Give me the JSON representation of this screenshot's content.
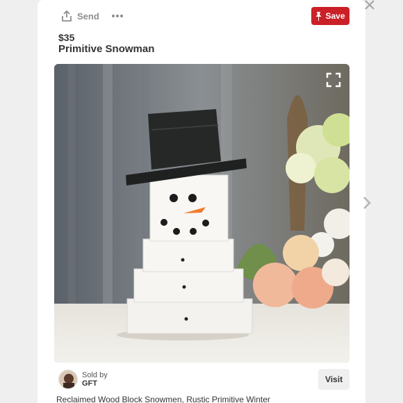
{
  "toolbar": {
    "send_label": "Send",
    "save_label": "Save",
    "accent_color": "#cb2027"
  },
  "product": {
    "price": "$35",
    "title": "Primitive Snowman",
    "description": "Reclaimed Wood Block Snowmen, Rustic Primitive Winter"
  },
  "seller": {
    "sold_by_label": "Sold by",
    "name": "GFT"
  },
  "actions": {
    "visit_label": "Visit"
  },
  "icons": {
    "send": "share-upload-icon",
    "more": "more-dots-icon",
    "save": "pin-icon",
    "expand": "expand-icon",
    "close": "close-icon",
    "next": "chevron-right-icon"
  }
}
